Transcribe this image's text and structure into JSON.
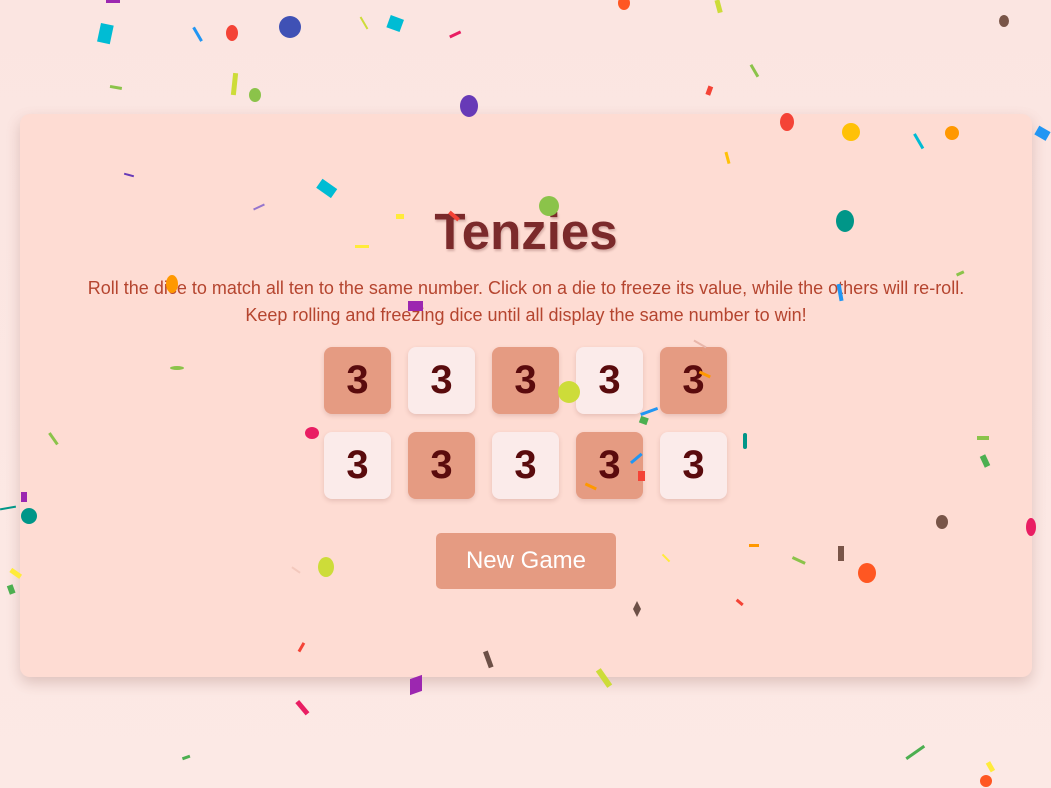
{
  "game": {
    "title": "Tenzies",
    "instructions_line1": "Roll the dice to match all ten to the same number. Click on a die to freeze its value, while the others will re-roll.",
    "instructions_line2": "Keep rolling and freezing dice until all display the same number to win!",
    "dice": [
      {
        "value": "3",
        "held": true
      },
      {
        "value": "3",
        "held": false
      },
      {
        "value": "3",
        "held": true
      },
      {
        "value": "3",
        "held": false
      },
      {
        "value": "3",
        "held": true
      },
      {
        "value": "3",
        "held": false
      },
      {
        "value": "3",
        "held": true
      },
      {
        "value": "3",
        "held": false
      },
      {
        "value": "3",
        "held": true
      },
      {
        "value": "3",
        "held": false
      }
    ],
    "new_game_label": "New Game"
  },
  "colors": {
    "card_background": "#fedcd3",
    "held_die": "#e59b82",
    "free_die": "#fbebea",
    "die_text": "#5a0b0d",
    "title": "#7b2a2b",
    "instructions_text": "#b5452f"
  }
}
